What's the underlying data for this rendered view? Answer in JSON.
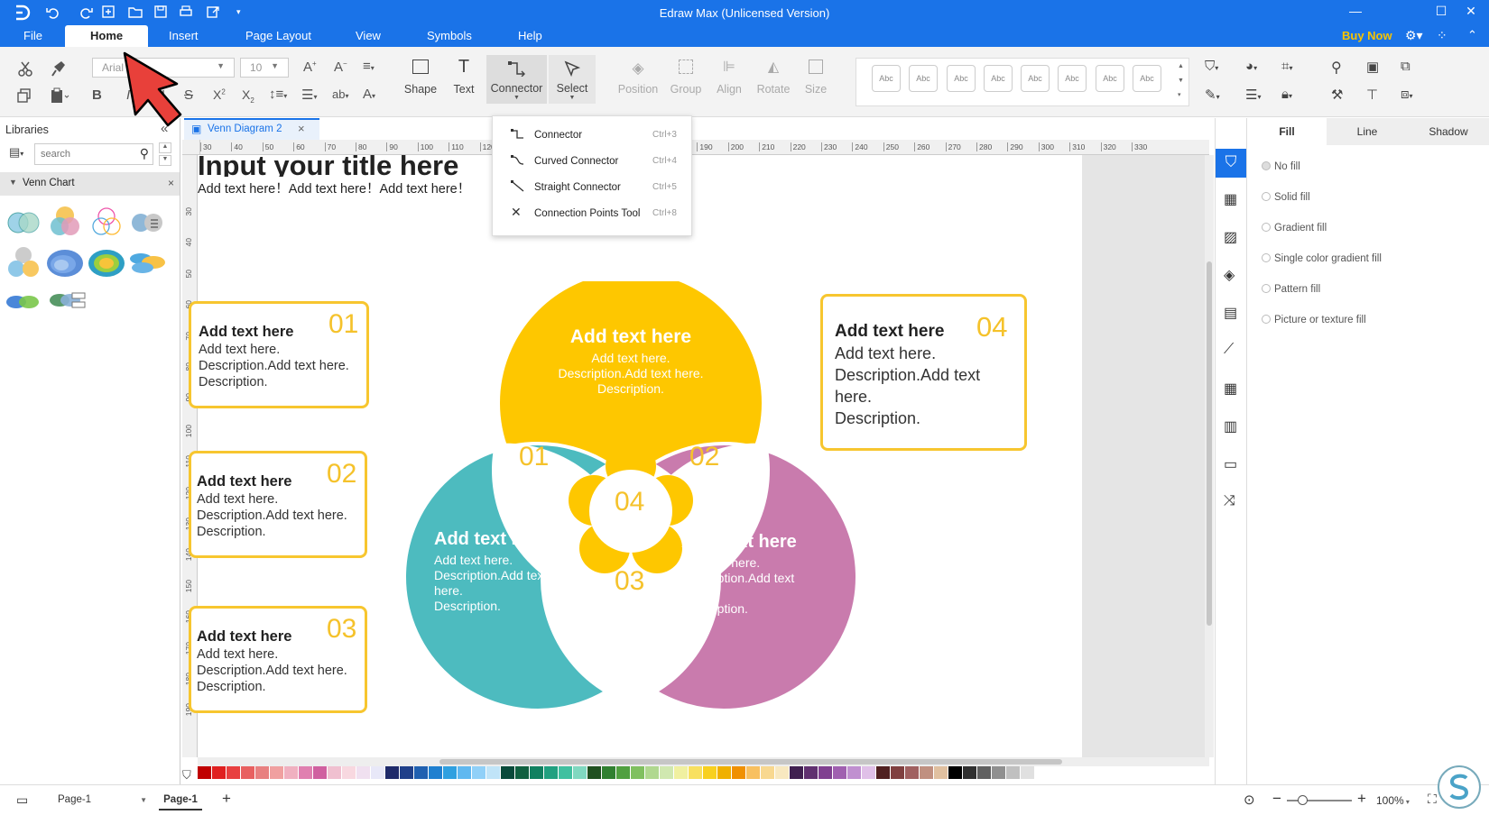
{
  "app": {
    "title": "Edraw Max (Unlicensed Version)",
    "buy_now": "Buy Now"
  },
  "menu": {
    "file": "File",
    "home": "Home",
    "insert": "Insert",
    "page_layout": "Page Layout",
    "view": "View",
    "symbols": "Symbols",
    "help": "Help"
  },
  "ribbon": {
    "font_name": "Arial",
    "font_size": "10",
    "shape": "Shape",
    "text": "Text",
    "connector": "Connector",
    "select": "Select",
    "position": "Position",
    "group": "Group",
    "align": "Align",
    "rotate": "Rotate",
    "size": "Size",
    "style_samples": [
      "Abc",
      "Abc",
      "Abc",
      "Abc",
      "Abc",
      "Abc",
      "Abc",
      "Abc"
    ]
  },
  "connector_menu": [
    {
      "label": "Connector",
      "shortcut": "Ctrl+3"
    },
    {
      "label": "Curved Connector",
      "shortcut": "Ctrl+4"
    },
    {
      "label": "Straight Connector",
      "shortcut": "Ctrl+5"
    },
    {
      "label": "Connection Points Tool",
      "shortcut": "Ctrl+8"
    }
  ],
  "libraries": {
    "title": "Libraries",
    "search_placeholder": "search",
    "category": "Venn Chart"
  },
  "doc_tab": "Venn Diagram 2",
  "ruler": {
    "h": [
      "30",
      "40",
      "50",
      "60",
      "70",
      "80",
      "90",
      "100",
      "110",
      "120",
      "130",
      "140",
      "150",
      "160",
      "170",
      "180",
      "190",
      "200",
      "210",
      "220",
      "230",
      "240",
      "250",
      "260",
      "270",
      "280",
      "290",
      "300",
      "310",
      "320",
      "330"
    ],
    "v": [
      "30",
      "40",
      "50",
      "60",
      "70",
      "80",
      "90",
      "100",
      "110",
      "120",
      "130",
      "140",
      "150",
      "160",
      "170",
      "180",
      "190"
    ]
  },
  "canvas": {
    "title": "Input your title here",
    "subtitle": "Add text here！Add text here！Add text here！",
    "boxes": [
      {
        "heading": "Add text here",
        "num": "01",
        "lines": [
          "Add text here.",
          "Description.Add text here.",
          "Description."
        ]
      },
      {
        "heading": "Add text here",
        "num": "02",
        "lines": [
          "Add text here.",
          "Description.Add text here.",
          "Description."
        ]
      },
      {
        "heading": "Add text here",
        "num": "03",
        "lines": [
          "Add text here.",
          "Description.Add text here.",
          "Description."
        ]
      },
      {
        "heading": "Add text here",
        "num": "04",
        "lines": [
          "Add text here.",
          "Description.Add text",
          "here.",
          "Description."
        ]
      }
    ],
    "venn": {
      "top": {
        "heading": "Add text here",
        "lines": [
          "Add text here.",
          "Description.Add text here.",
          "Description."
        ]
      },
      "left": {
        "heading": "Add text here",
        "lines": [
          "Add text here.",
          "Description.Add text",
          "here.",
          "Description."
        ]
      },
      "right": {
        "heading": "Add text here",
        "lines": [
          "Add text here.",
          "Description.Add text",
          "here.",
          "Description."
        ]
      },
      "n01": "01",
      "n02": "02",
      "n03": "03",
      "n04": "04"
    },
    "colors": {
      "yellow": "#fec700",
      "teal": "#4dbbbf",
      "pink": "#c97bad",
      "box_border": "#f7c62f"
    }
  },
  "right_panel": {
    "tabs": [
      "Fill",
      "Line",
      "Shadow"
    ],
    "fill_options": [
      "No fill",
      "Solid fill",
      "Gradient fill",
      "Single color gradient fill",
      "Pattern fill",
      "Picture or texture fill"
    ]
  },
  "status": {
    "page_select": "Page-1",
    "page_tab": "Page-1",
    "add": "+",
    "zoom": "100%"
  },
  "palette": [
    "#c00000",
    "#e02020",
    "#e84040",
    "#e86060",
    "#e88080",
    "#f0a0a0",
    "#f0b0c0",
    "#e080b0",
    "#d060a0",
    "#f0c0d0",
    "#f8d8e0",
    "#f0e0f0",
    "#e8e8f8",
    "#1f2a6a",
    "#20408a",
    "#2060b0",
    "#2080d0",
    "#30a0e0",
    "#60b8f0",
    "#90d0f8",
    "#c0e4f8",
    "#0a4a3a",
    "#106040",
    "#108060",
    "#20a080",
    "#40c0a0",
    "#80d8c0",
    "#205020",
    "#308030",
    "#50a040",
    "#80c060",
    "#b0d890",
    "#d0e8b0",
    "#f0f0a0",
    "#f8e060",
    "#f8d020",
    "#f0b000",
    "#f09000",
    "#f8c060",
    "#f8d890",
    "#f8e8c0",
    "#402050",
    "#603070",
    "#804090",
    "#a060b0",
    "#c090d0",
    "#e0c0e8",
    "#502020",
    "#804040",
    "#a06060",
    "#c09080",
    "#e0c0a0",
    "#000000",
    "#303030",
    "#606060",
    "#909090",
    "#c0c0c0",
    "#e0e0e0",
    "#ffffff"
  ]
}
